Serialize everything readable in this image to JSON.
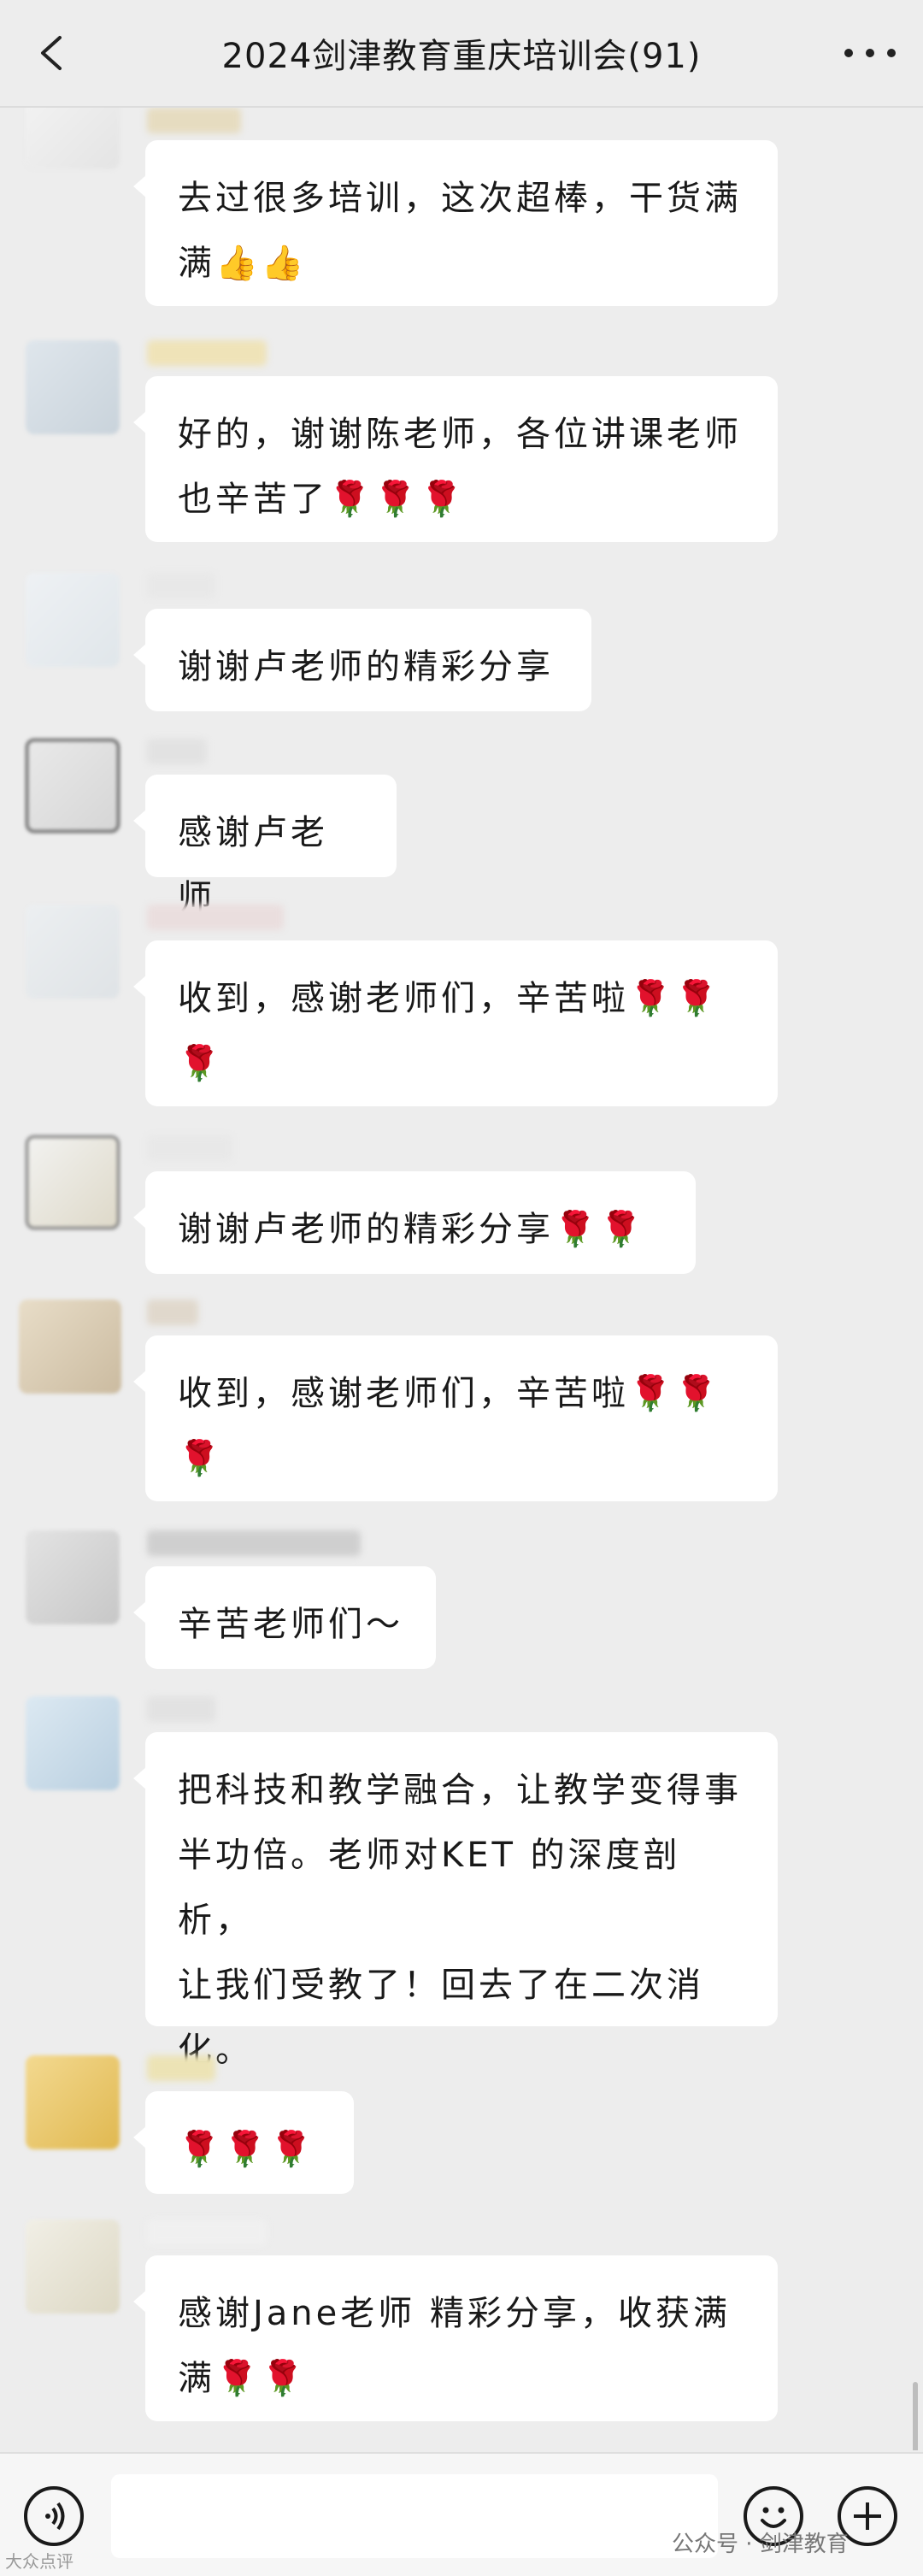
{
  "header": {
    "title": "2024剑津教育重庆培训会(91)",
    "back_icon": "chevron-left-icon",
    "more_icon": "more-dots-icon"
  },
  "messages": [
    {
      "text": "去过很多培训，这次超棒，干货满\n满👍👍"
    },
    {
      "text": "好的，谢谢陈老师，各位讲课老师\n也辛苦了🌹🌹🌹"
    },
    {
      "text": "谢谢卢老师的精彩分享"
    },
    {
      "text": "感谢卢老师"
    },
    {
      "text": "收到，感谢老师们，辛苦啦🌹🌹\n🌹"
    },
    {
      "text": "谢谢卢老师的精彩分享🌹🌹"
    },
    {
      "text": "收到，感谢老师们，辛苦啦🌹🌹\n🌹"
    },
    {
      "text": "辛苦老师们～"
    },
    {
      "text": "把科技和教学融合，让教学变得事\n半功倍。老师对KET 的深度剖析，\n让我们受教了！回去了在二次消\n化。"
    },
    {
      "text": "🌹🌹🌹"
    },
    {
      "text": "感谢Jane老师 精彩分享，收获满\n满🌹🌹"
    }
  ],
  "footer": {
    "voice_icon": "voice-icon",
    "emoji_icon": "emoji-icon",
    "plus_icon": "plus-icon",
    "watermark": "公众号 · 剑津教育",
    "watermark_left": "大众点评"
  }
}
